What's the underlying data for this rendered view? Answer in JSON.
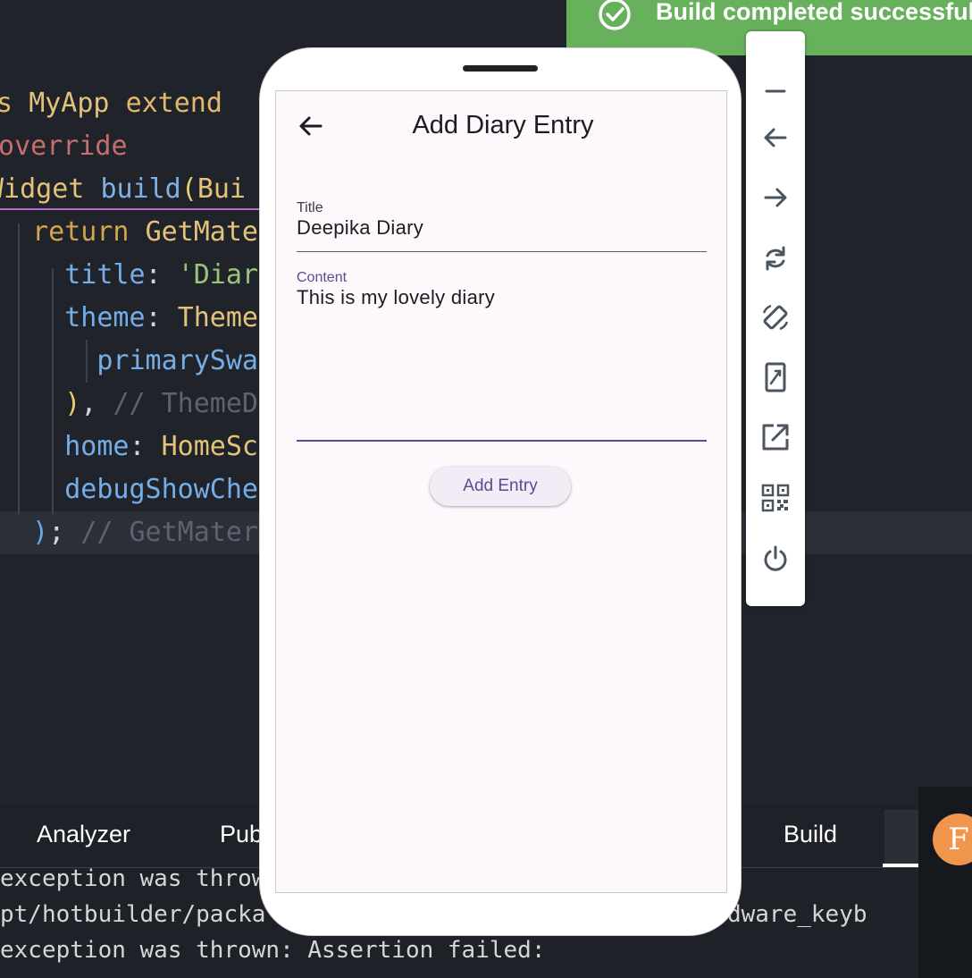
{
  "editor": {
    "lines": [
      {
        "parts": [
          {
            "t": "ss ",
            "c": "kw"
          },
          {
            "t": "MyApp ",
            "c": "id"
          },
          {
            "t": "extend",
            "c": "kw"
          }
        ]
      },
      {
        "parts": [
          {
            "t": "@override",
            "c": "ann"
          }
        ]
      },
      {
        "parts": [
          {
            "t": "Widget ",
            "c": "id"
          },
          {
            "t": "build",
            "c": "fn"
          },
          {
            "t": "(",
            "c": "paren"
          },
          {
            "t": "Bui",
            "c": "id"
          }
        ]
      },
      {
        "parts": [
          {
            "t": "  return ",
            "c": "kw2"
          },
          {
            "t": "GetMate",
            "c": "id"
          }
        ]
      },
      {
        "parts": [
          {
            "t": "    title",
            "c": "prop"
          },
          {
            "t": ": ",
            "c": "pl"
          },
          {
            "t": "'Diar",
            "c": "str"
          }
        ]
      },
      {
        "parts": [
          {
            "t": "    theme",
            "c": "prop"
          },
          {
            "t": ": ",
            "c": "pl"
          },
          {
            "t": "Theme",
            "c": "id"
          }
        ]
      },
      {
        "parts": [
          {
            "t": "      primarySwa",
            "c": "prop"
          }
        ]
      },
      {
        "parts": [
          {
            "t": "    )",
            "c": "paren"
          },
          {
            "t": ", ",
            "c": "pl"
          },
          {
            "t": "// ThemeD",
            "c": "cm"
          }
        ]
      },
      {
        "parts": [
          {
            "t": "    home",
            "c": "prop"
          },
          {
            "t": ": ",
            "c": "pl"
          },
          {
            "t": "HomeSc",
            "c": "id"
          }
        ]
      },
      {
        "parts": [
          {
            "t": "    debugShowChe",
            "c": "prop"
          }
        ]
      },
      {
        "parts": [
          {
            "t": "  )",
            "c": "paren2"
          },
          {
            "t": "; ",
            "c": "pl"
          },
          {
            "t": "// GetMater",
            "c": "cm"
          }
        ]
      }
    ]
  },
  "toast": {
    "text": "Build completed successfully"
  },
  "panel": {
    "tabs": {
      "analyzer": "Analyzer",
      "pub": "Pub",
      "build": "Build"
    },
    "console": [
      "exception was thrown: Assertion failed:",
      "pt/hotbuilder/packa                              hardware_keyb",
      "exception was thrown: Assertion failed:"
    ],
    "avatar_letter": "F"
  },
  "app": {
    "title": "Add Diary Entry",
    "title_field": {
      "label": "Title",
      "value": "Deepika Diary"
    },
    "content_field": {
      "label": "Content",
      "value": "This is my lovely diary"
    },
    "button": "Add Entry",
    "colors": {
      "accent": "#5a4b94",
      "background": "#fcf8fc",
      "toast": "#67b15c"
    }
  },
  "toolbar": {
    "icons": [
      "minimize-icon",
      "back-icon",
      "forward-icon",
      "rotate-icon",
      "rotate-device-icon",
      "resize-icon",
      "open-external-icon",
      "qr-code-icon",
      "power-icon"
    ]
  }
}
